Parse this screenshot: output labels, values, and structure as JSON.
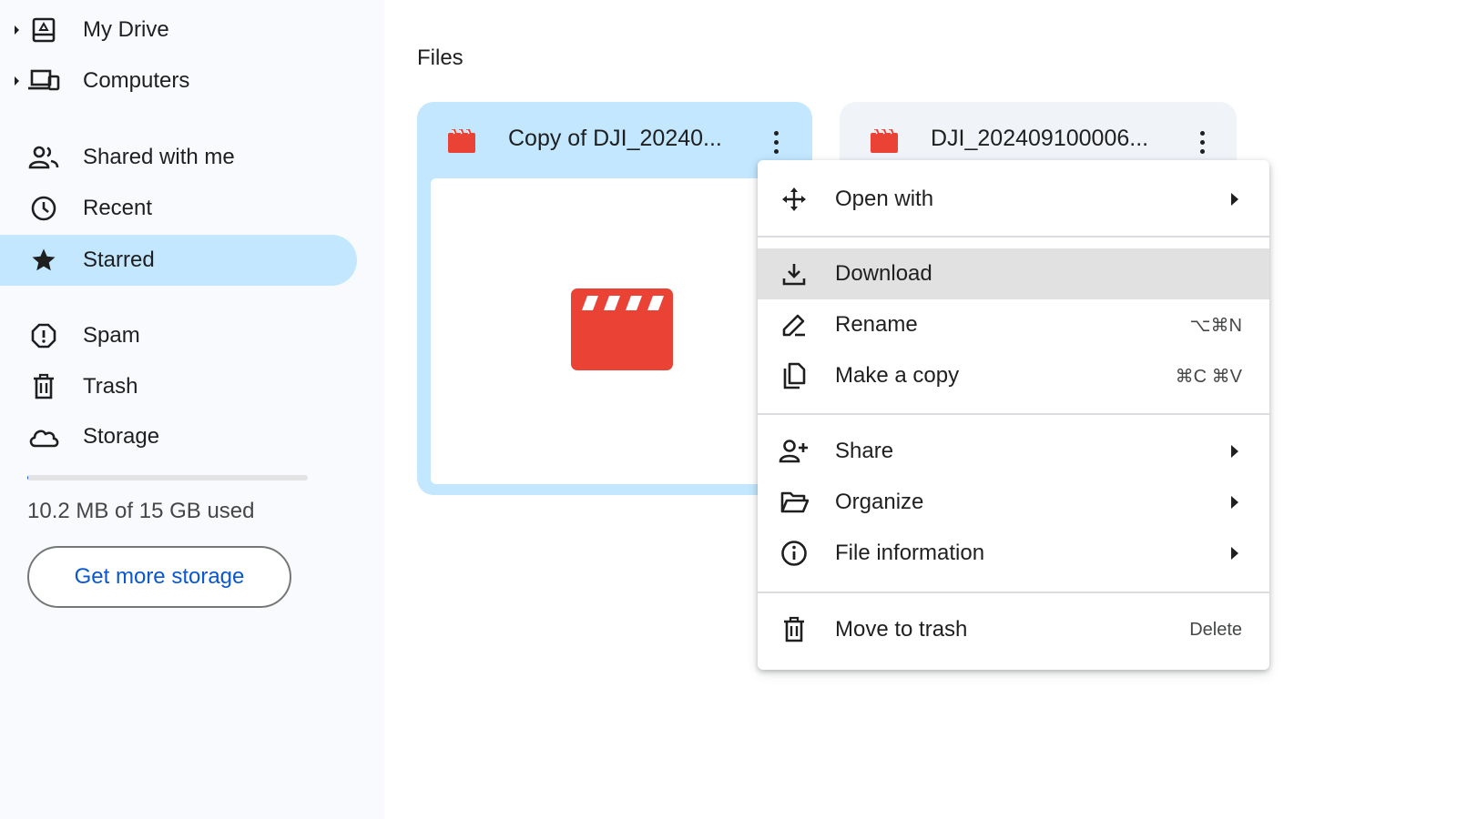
{
  "sidebar": {
    "items": [
      {
        "label": "My Drive",
        "icon": "my-drive-icon"
      },
      {
        "label": "Computers",
        "icon": "computers-icon"
      },
      {
        "label": "Shared with me",
        "icon": "shared-with-me-icon"
      },
      {
        "label": "Recent",
        "icon": "clock-icon"
      },
      {
        "label": "Starred",
        "icon": "star-icon",
        "active": true
      },
      {
        "label": "Spam",
        "icon": "spam-icon"
      },
      {
        "label": "Trash",
        "icon": "trash-icon"
      },
      {
        "label": "Storage",
        "icon": "cloud-icon"
      }
    ],
    "storage": {
      "used_text": "10.2 MB of 15 GB used",
      "used_fraction": 0.0007,
      "button_label": "Get more storage"
    }
  },
  "main": {
    "section_title": "Files",
    "files": [
      {
        "name": "Copy of DJI_20240...",
        "selected": true,
        "icon": "video-file-icon"
      },
      {
        "name": "DJI_202409100006...",
        "selected": false,
        "icon": "video-file-icon"
      }
    ]
  },
  "context_menu": {
    "open_with": "Open with",
    "download": "Download",
    "rename": "Rename",
    "rename_shortcut": "⌥⌘N",
    "make_copy": "Make a copy",
    "make_copy_shortcut": "⌘C ⌘V",
    "share": "Share",
    "organize": "Organize",
    "file_information": "File information",
    "move_to_trash": "Move to trash",
    "move_to_trash_shortcut": "Delete"
  },
  "colors": {
    "accent_blue": "#0b57d0",
    "selected_bg": "#c2e7ff",
    "video_red": "#ea4335",
    "menu_hover": "#e1e1e1"
  }
}
